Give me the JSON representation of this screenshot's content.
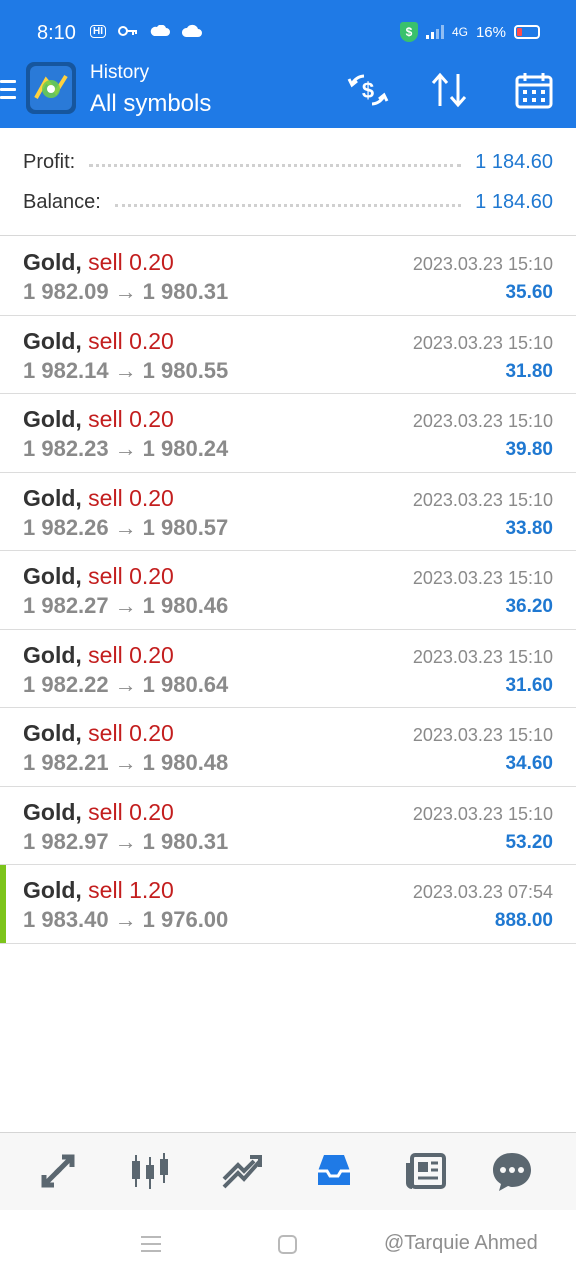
{
  "status_bar": {
    "time": "8:10",
    "network": "4G",
    "battery": "16%"
  },
  "header": {
    "title": "History",
    "subtitle": "All symbols",
    "icons": [
      "menu-icon",
      "metatrader-logo",
      "currency-exchange-icon",
      "sort-icon",
      "calendar-icon"
    ]
  },
  "summary": {
    "profit_label": "Profit:",
    "profit_value": "1 184.60",
    "balance_label": "Balance:",
    "balance_value": "1 184.60"
  },
  "trades": [
    {
      "symbol": "Gold,",
      "side": "sell 0.20",
      "open": "1 982.09",
      "close": "1 980.31",
      "time": "2023.03.23 15:10",
      "profit": "35.60"
    },
    {
      "symbol": "Gold,",
      "side": "sell 0.20",
      "open": "1 982.14",
      "close": "1 980.55",
      "time": "2023.03.23 15:10",
      "profit": "31.80"
    },
    {
      "symbol": "Gold,",
      "side": "sell 0.20",
      "open": "1 982.23",
      "close": "1 980.24",
      "time": "2023.03.23 15:10",
      "profit": "39.80"
    },
    {
      "symbol": "Gold,",
      "side": "sell 0.20",
      "open": "1 982.26",
      "close": "1 980.57",
      "time": "2023.03.23 15:10",
      "profit": "33.80"
    },
    {
      "symbol": "Gold,",
      "side": "sell 0.20",
      "open": "1 982.27",
      "close": "1 980.46",
      "time": "2023.03.23 15:10",
      "profit": "36.20"
    },
    {
      "symbol": "Gold,",
      "side": "sell 0.20",
      "open": "1 982.22",
      "close": "1 980.64",
      "time": "2023.03.23 15:10",
      "profit": "31.60"
    },
    {
      "symbol": "Gold,",
      "side": "sell 0.20",
      "open": "1 982.21",
      "close": "1 980.48",
      "time": "2023.03.23 15:10",
      "profit": "34.60"
    },
    {
      "symbol": "Gold,",
      "side": "sell 0.20",
      "open": "1 982.97",
      "close": "1 980.31",
      "time": "2023.03.23 15:10",
      "profit": "53.20"
    },
    {
      "symbol": "Gold,",
      "side": "sell 1.20",
      "open": "1 983.40",
      "close": "1 976.00",
      "time": "2023.03.23 07:54",
      "profit": "888.00"
    }
  ],
  "arrow": "→",
  "bottom_nav": {
    "items": [
      "quotes-icon",
      "chart-icon",
      "trade-icon",
      "history-icon",
      "news-icon",
      "messages-icon"
    ],
    "active": "history-icon",
    "active_color": "#1f7ae6"
  },
  "watermark": "@Tarquie Ahmed",
  "colors": {
    "brand": "#1f7ae6",
    "sell": "#c31e1e",
    "profit": "#1f78d1",
    "selected_marker": "#7cc41b"
  }
}
